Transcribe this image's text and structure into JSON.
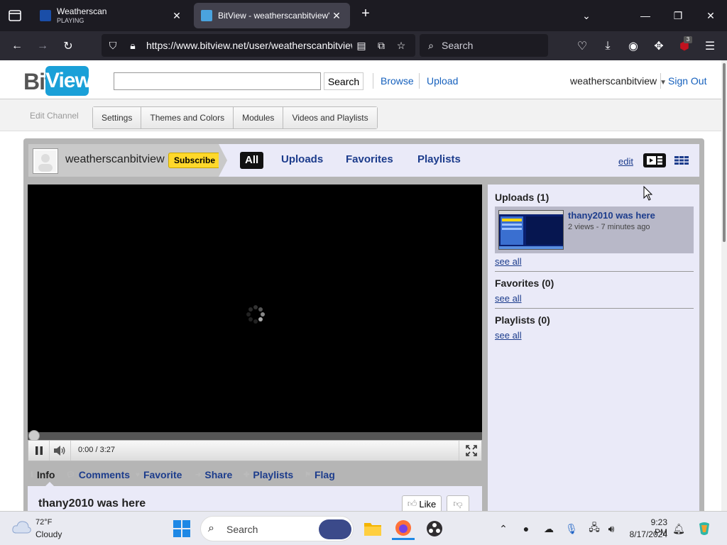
{
  "browser": {
    "tabs": [
      {
        "title": "Weatherscan",
        "subtitle": "PLAYING",
        "favicon": "weatherscan-icon"
      },
      {
        "title": "BitView - weatherscanbitview's",
        "favicon": "bitview-icon"
      }
    ],
    "url": "https://www.bitview.net/user/weatherscanbitview",
    "search_placeholder": "Search",
    "extension_badge": "3"
  },
  "site": {
    "logo_left": "Bit",
    "logo_right": "View",
    "search_button": "Search",
    "nav": [
      "Browse",
      "Upload"
    ],
    "username": "weatherscanbitview",
    "sign_out": "Sign Out",
    "edit_label": "Edit Channel",
    "edit_tabs": [
      "Settings",
      "Themes and Colors",
      "Modules",
      "Videos and Playlists"
    ]
  },
  "channel": {
    "name": "weatherscanbitview",
    "subscribe": "Subscribe",
    "tabs": [
      "All",
      "Uploads",
      "Favorites",
      "Playlists"
    ],
    "edit": "edit"
  },
  "player": {
    "time": "0:00 / 3:27",
    "progress": 0
  },
  "info": {
    "tabs": [
      "Info",
      "Comments",
      "Favorite",
      "Share",
      "Playlists",
      "Flag"
    ],
    "title": "thany2010 was here",
    "like": "Like"
  },
  "sidebar": {
    "uploads_heading": "Uploads (1)",
    "video_title": "thany2010 was here",
    "video_meta": "2 views - 7 minutes ago",
    "see_all": "see all",
    "favorites_heading": "Favorites (0)",
    "playlists_heading": "Playlists (0)"
  },
  "taskbar": {
    "temp": "72°F",
    "condition": "Cloudy",
    "search": "Search",
    "time": "9:23 PM",
    "date": "8/17/2024"
  },
  "colors": {
    "accent": "#1c3c8c",
    "subscribe": "#ffd82a",
    "logo": "#1aa0d8"
  }
}
